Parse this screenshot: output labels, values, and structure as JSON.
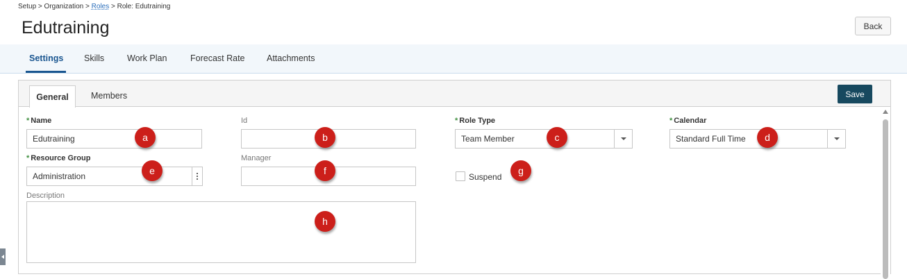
{
  "breadcrumb": {
    "setup": "Setup",
    "sep1": " > ",
    "organization": "Organization",
    "sep2": " > ",
    "roles": "Roles",
    "sep3": " > ",
    "current": "Role: Edutraining"
  },
  "page": {
    "title": "Edutraining",
    "back_label": "Back"
  },
  "main_tabs": [
    {
      "label": "Settings",
      "active": true
    },
    {
      "label": "Skills"
    },
    {
      "label": "Work Plan"
    },
    {
      "label": "Forecast Rate"
    },
    {
      "label": "Attachments"
    }
  ],
  "sub_tabs": [
    {
      "label": "General",
      "active": true
    },
    {
      "label": "Members"
    }
  ],
  "save_label": "Save",
  "form": {
    "required_mark": "*",
    "name": {
      "label": "Name",
      "value": "Edutraining",
      "required": true
    },
    "id": {
      "label": "Id",
      "value": ""
    },
    "role_type": {
      "label": "Role Type",
      "value": "Team Member",
      "required": true
    },
    "calendar": {
      "label": "Calendar",
      "value": "Standard Full Time",
      "required": true
    },
    "resource_group": {
      "label": "Resource Group",
      "value": "Administration",
      "required": true
    },
    "manager": {
      "label": "Manager",
      "value": ""
    },
    "suspend": {
      "label": "Suspend",
      "checked": false
    },
    "description": {
      "label": "Description",
      "value": ""
    }
  },
  "annotations": [
    "a",
    "b",
    "c",
    "d",
    "e",
    "f",
    "g",
    "h"
  ],
  "colors": {
    "accent": "#1a5690",
    "save_button": "#17495f",
    "badge": "#cc1f1a",
    "required": "#3f8f3f",
    "tab_bar": "#f2f7fb"
  },
  "icons": {
    "dropdown": "chevron-down-icon",
    "more": "kebab-menu-icon",
    "scroll_up": "arrow-up-icon",
    "collapse": "chevron-left-icon"
  }
}
